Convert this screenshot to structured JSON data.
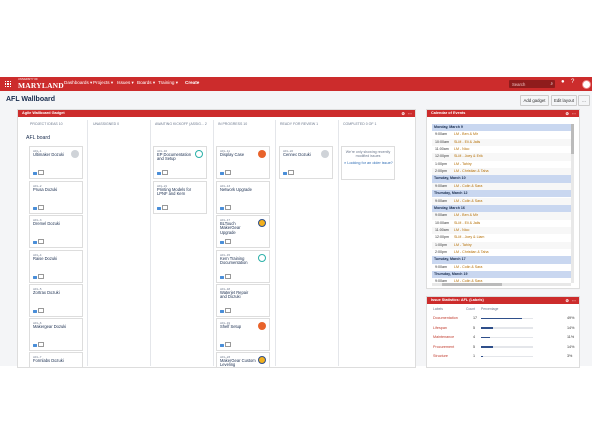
{
  "nav": {
    "logo": "MARYLAND",
    "logo_small": "UNIVERSITY OF",
    "items": [
      "Dashboards ▾",
      "Projects ▾",
      "Issues ▾",
      "Boards ▾",
      "Training ▾"
    ],
    "create": "Create",
    "search_placeholder": "Search"
  },
  "page": {
    "title": "AFL Wallboard",
    "add_gadget": "Add gadget",
    "edit_layout": "Edit layout",
    "more": "..."
  },
  "wallboard": {
    "gadget_title": "Agile Wallboard Gadget",
    "board_title": "AFL board",
    "columns": [
      "PROJECT IDEAS 10",
      "UNASSIGNED 0",
      "AWAITING KICKOFF (ASSIG... 2",
      "IN PROGRESS 10",
      "READY FOR REVIEW 1",
      "COMPLETED 0 OF 1"
    ],
    "col1": [
      {
        "key": "AFL-1",
        "title": "Ultimaker Dozuki"
      },
      {
        "key": "AFL-2",
        "title": "Prusa Dozuki"
      },
      {
        "key": "AFL-3",
        "title": "Dremel Dozuki"
      },
      {
        "key": "AFL-4",
        "title": "Raise Dozuki"
      },
      {
        "key": "AFL-5",
        "title": "Zortrax Dozuki"
      },
      {
        "key": "AFL-6",
        "title": "Makergear Dozuki"
      },
      {
        "key": "AFL-7",
        "title": "Formlabs Dozuki"
      }
    ],
    "col3": [
      {
        "key": "AFL-16",
        "title": "EP Documentation and Setup"
      },
      {
        "key": "AFL-21",
        "title": "Printing Models for LPNF and Kern"
      }
    ],
    "col4": [
      {
        "key": "AFL-11",
        "title": "Display Case"
      },
      {
        "key": "AFL-13",
        "title": "Network Upgrade"
      },
      {
        "key": "AFL-17",
        "title": "BLTouch MakerGear Upgrade"
      },
      {
        "key": "AFL-15",
        "title": "Kern Training Documentation"
      },
      {
        "key": "AFL-18",
        "title": "Waterjet Repair and Dozuki"
      },
      {
        "key": "AFL-19",
        "title": "Shelf Setup"
      },
      {
        "key": "AFL-23",
        "title": "MakerGear Custom Leveling"
      }
    ],
    "col5": [
      {
        "key": "AFL-22",
        "title": "Cennec Dozuki"
      }
    ],
    "completed_note": "We're only showing recently modified issues",
    "older_link": "Looking for an older issue?"
  },
  "calendar": {
    "title": "Calendar of Events",
    "rows": [
      {
        "type": "date",
        "text": "Monday, March 9"
      },
      {
        "type": "event",
        "time": "9:00am",
        "text": "LM - Ben & Mir"
      },
      {
        "type": "event",
        "time": "10:00am",
        "text": "SLM - Eli & Jalis"
      },
      {
        "type": "event",
        "time": "11:00am",
        "text": "LM - Nico"
      },
      {
        "type": "event",
        "time": "12:00pm",
        "text": "SLM - Joey & Erik"
      },
      {
        "type": "event",
        "time": "1:00pm",
        "text": "LM - Tahiry"
      },
      {
        "type": "event",
        "time": "2:00pm",
        "text": "LM - Christian & Taha"
      },
      {
        "type": "date",
        "text": "Tuesday, March 10"
      },
      {
        "type": "event",
        "time": "9:00am",
        "text": "LM - Colin & Sara"
      },
      {
        "type": "date",
        "text": "Thursday, March 12"
      },
      {
        "type": "event",
        "time": "9:00am",
        "text": "LM - Colin & Sara"
      },
      {
        "type": "date",
        "text": "Monday, March 16"
      },
      {
        "type": "event",
        "time": "9:00am",
        "text": "LM - Ben & Mir"
      },
      {
        "type": "event",
        "time": "10:00am",
        "text": "SLM - Eli & Jalis"
      },
      {
        "type": "event",
        "time": "11:00am",
        "text": "LM - Nico"
      },
      {
        "type": "event",
        "time": "12:00pm",
        "text": "SLM - Joey & Liam"
      },
      {
        "type": "event",
        "time": "1:00pm",
        "text": "LM - Tahiry"
      },
      {
        "type": "event",
        "time": "2:00pm",
        "text": "LM - Christian & Taha"
      },
      {
        "type": "date",
        "text": "Tuesday, March 17"
      },
      {
        "type": "event",
        "time": "9:00am",
        "text": "LM - Colin & Sara"
      },
      {
        "type": "date",
        "text": "Thursday, March 19"
      },
      {
        "type": "event",
        "time": "9:00am",
        "text": "LM - Colin & Sara"
      }
    ]
  },
  "stats": {
    "title": "Issue Statistics: AFL (Labels)",
    "headers": [
      "Labels",
      "Count",
      "Percentage"
    ],
    "rows": [
      {
        "label": "Documentation",
        "count": "17",
        "pct": "49%",
        "fraction": 0.49
      },
      {
        "label": "Lifespan",
        "count": "5",
        "pct": "14%",
        "fraction": 0.14
      },
      {
        "label": "Maintenance",
        "count": "4",
        "pct": "11%",
        "fraction": 0.11
      },
      {
        "label": "Procurement",
        "count": "5",
        "pct": "14%",
        "fraction": 0.14
      },
      {
        "label": "Structure",
        "count": "1",
        "pct": "3%",
        "fraction": 0.03
      }
    ]
  },
  "colors": {
    "brand": "#cc2c2c",
    "link": "#c0392b",
    "bar": "#2f4f8a"
  }
}
